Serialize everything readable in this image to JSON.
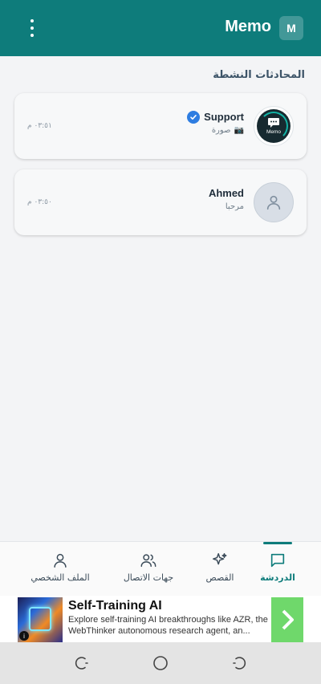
{
  "header": {
    "app_title": "Memo",
    "avatar_initial": "M",
    "background_color": "#0e7c7b"
  },
  "main": {
    "section_title": "المحادثات النشطة",
    "chats": [
      {
        "name": "Support",
        "verified": true,
        "last_message_icon": "camera-icon",
        "last_message": "صورة",
        "time": "٠٣:٥١ م",
        "avatar": "memo-logo-icon",
        "avatar_text": "Memo"
      },
      {
        "name": "Ahmed",
        "verified": false,
        "last_message": "مرحبا",
        "time": "٠٣:٥٠ م",
        "avatar": "person-icon"
      }
    ]
  },
  "bottom_nav": {
    "items": [
      {
        "label": "الدردشة",
        "icon": "chat-bubble-icon",
        "active": true
      },
      {
        "label": "القصص",
        "icon": "sparkles-icon",
        "active": false
      },
      {
        "label": "جهات الاتصال",
        "icon": "users-icon",
        "active": false
      },
      {
        "label": "الملف الشخصي",
        "icon": "user-icon",
        "active": false
      }
    ]
  },
  "ad": {
    "title": "Self-Training AI",
    "description": "Explore self-training AI breakthroughs like AZR, the WebThinker autonomous research agent, an...",
    "info_label": "i",
    "cta_icon": "chevron-right-icon",
    "cta_color": "#6fd86b"
  },
  "system_nav": {
    "buttons": [
      "recent-apps-icon",
      "home-icon",
      "back-icon"
    ]
  }
}
